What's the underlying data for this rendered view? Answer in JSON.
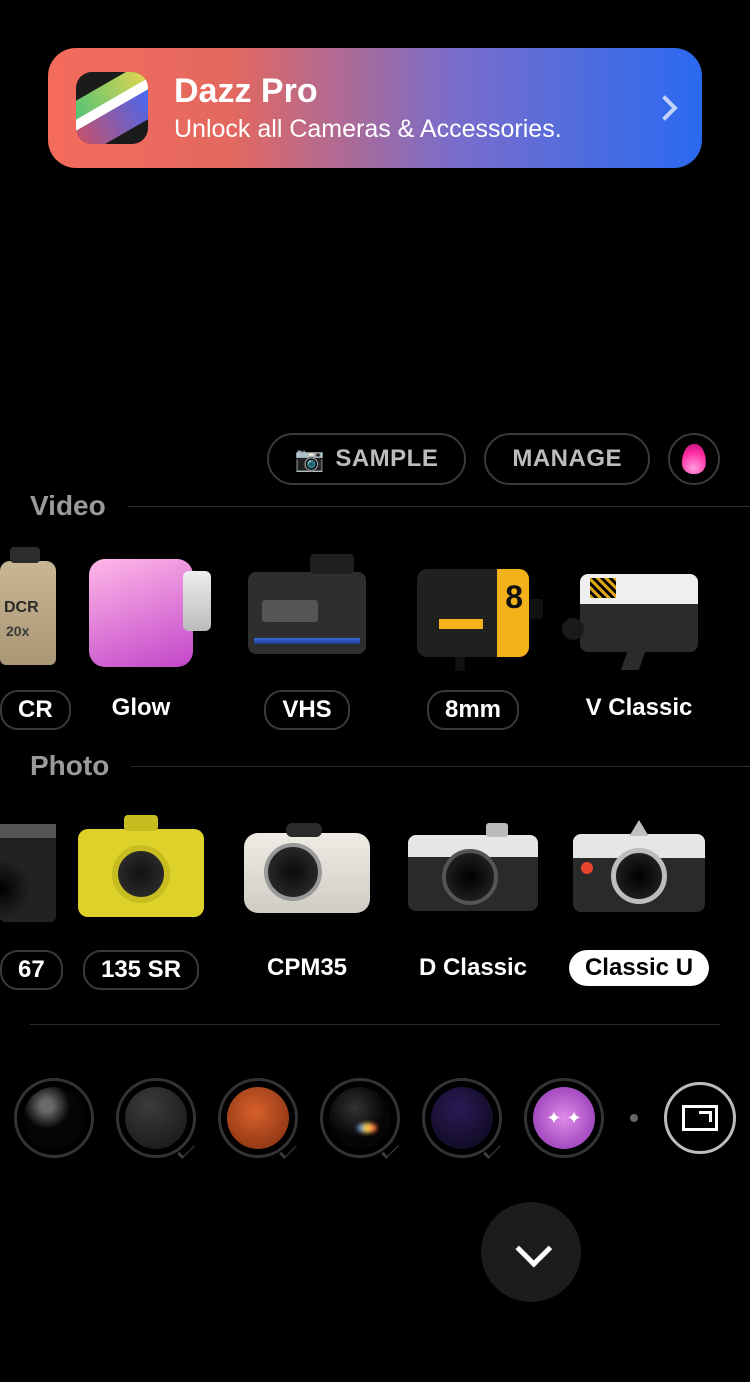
{
  "promo": {
    "title": "Dazz Pro",
    "subtitle": "Unlock all Cameras & Accessories."
  },
  "controls": {
    "sample_label": "SAMPLE",
    "manage_label": "MANAGE"
  },
  "sections": {
    "video_label": "Video",
    "photo_label": "Photo"
  },
  "video_items": [
    {
      "label": "CR",
      "badge": "pill",
      "icon": "dcr-camcorder"
    },
    {
      "label": "Glow",
      "badge": "none",
      "icon": "glow-camcorder"
    },
    {
      "label": "VHS",
      "badge": "pill",
      "icon": "vhs-camcorder"
    },
    {
      "label": "8mm",
      "badge": "pill",
      "icon": "8mm-camcorder"
    },
    {
      "label": "V Classic",
      "badge": "none",
      "icon": "vclassic-camcorder"
    }
  ],
  "photo_items": [
    {
      "label": "67",
      "badge": "pill",
      "icon": "67-camera"
    },
    {
      "label": "135 SR",
      "badge": "pill",
      "icon": "135sr-camera"
    },
    {
      "label": "CPM35",
      "badge": "none",
      "icon": "cpm35-camera"
    },
    {
      "label": "D Classic",
      "badge": "none",
      "icon": "dclassic-camera"
    },
    {
      "label": "Classic U",
      "badge": "solid",
      "icon": "classicu-camera",
      "selected": true
    }
  ],
  "lenses": [
    {
      "name": "lens-glossy-black"
    },
    {
      "name": "lens-matte-grey"
    },
    {
      "name": "lens-orange"
    },
    {
      "name": "lens-prism"
    },
    {
      "name": "lens-violet"
    },
    {
      "name": "lens-sparkle-purple"
    }
  ]
}
